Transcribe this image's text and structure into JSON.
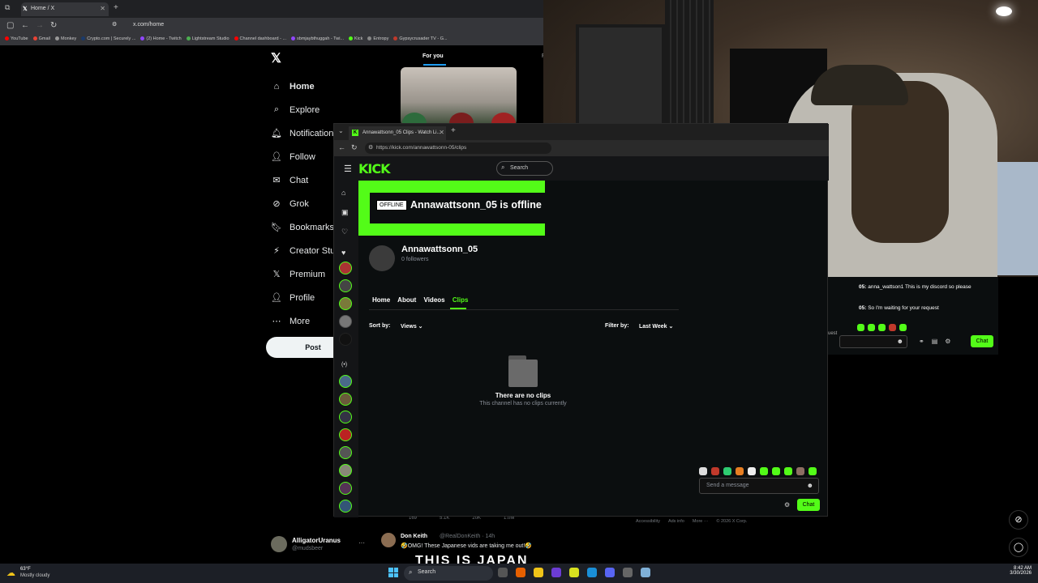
{
  "browser": {
    "tab_title": "Home / X",
    "url": "x.com/home",
    "bookmarks": [
      "YouTube",
      "Gmail",
      "Monkey",
      "Crypto.com | Securely ...",
      "(2) Home - Twitch",
      "Lightstream Studio",
      "Channel dashboard - ...",
      "sbmjaybthuggah - Twi...",
      "Kick",
      "Entropy",
      "Gypsycrusader TV - G..."
    ]
  },
  "x": {
    "nav": [
      {
        "label": "Home",
        "icon": "⌂"
      },
      {
        "label": "Explore",
        "icon": "⌕"
      },
      {
        "label": "Notifications",
        "icon": "🔔︎"
      },
      {
        "label": "Follow",
        "icon": "👤︎"
      },
      {
        "label": "Chat",
        "icon": "✉"
      },
      {
        "label": "Grok",
        "icon": "⊘"
      },
      {
        "label": "Bookmarks",
        "icon": "🔖︎"
      },
      {
        "label": "Creator Studio",
        "icon": "⚡︎"
      },
      {
        "label": "Premium",
        "icon": "𝕏"
      },
      {
        "label": "Profile",
        "icon": "👤︎"
      },
      {
        "label": "More",
        "icon": "⋯"
      }
    ],
    "post_label": "Post",
    "account": {
      "name": "AlligatorUranus",
      "handle": "@mudsbeer"
    },
    "timeline_tab": "For you",
    "tweet_stats": [
      "169",
      "5.1K",
      "20K",
      "1.0M"
    ],
    "tweet": {
      "name": "Don Keith",
      "handle": "@RealDonKeith · 14h",
      "text": "🤣OMG! These Japanese vids are taking me out!🤣",
      "overlay": "THIS IS JAPAN"
    },
    "footer": [
      "Accessibility",
      "Ads info",
      "More ···",
      "© 2026 X Corp."
    ]
  },
  "kick": {
    "tab_title": "Annawattsonn_05 Clips - Watch Li...",
    "url": "https://kick.com/annawattsonn-05/clips",
    "logo": "KICK",
    "search_placeholder": "Search",
    "offline_badge": "OFFLINE",
    "offline_message": "Annawattsonn_05 is offline",
    "channel_name": "Annawattsonn_05",
    "followers": "0 followers",
    "tabs": [
      "Home",
      "About",
      "Videos",
      "Clips"
    ],
    "sort_label": "Sort by:",
    "sort_value": "Views",
    "filter_label": "Filter by:",
    "filter_value": "Last Week",
    "empty_title": "There are no clips",
    "empty_sub": "This channel has no clips currently",
    "message_placeholder": "Send a message",
    "chat_button": "Chat",
    "accent": "#53fc18"
  },
  "chat_overlay": {
    "lines": [
      {
        "user": "05:",
        "text": " anna_wattson1 This is my discord so please"
      },
      {
        "user": "05:",
        "text": " So I'm waiting for your request"
      }
    ],
    "quest_fragment": "uest",
    "chat_button": "Chat"
  },
  "taskbar": {
    "temp": "63°F",
    "weather": "Mostly cloudy",
    "search": "Search",
    "time": "8:42 AM",
    "date": "3/30/2026"
  }
}
